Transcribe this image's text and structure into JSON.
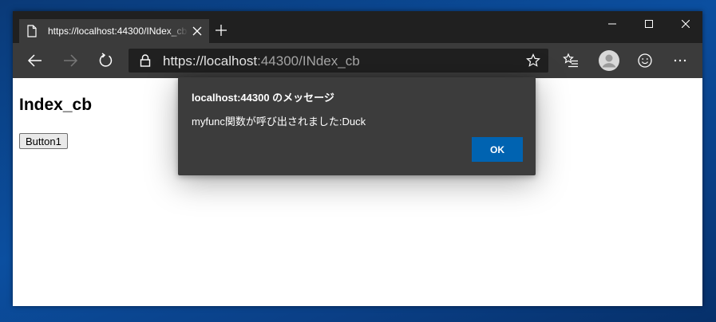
{
  "browser": {
    "tab": {
      "title": "https://localhost:44300/INdex_cb"
    },
    "address_bar": {
      "url_scheme_host": "https://localhost",
      "url_rest": ":44300/INdex_cb"
    },
    "icons": {
      "tab": "page-icon",
      "new_tab": "plus-icon",
      "back": "back-arrow-icon",
      "forward": "forward-arrow-icon",
      "refresh": "refresh-icon",
      "lock": "lock-icon",
      "favorite": "star-icon",
      "favorites": "favorites-list-icon",
      "profile": "avatar-icon",
      "feedback": "smiley-icon",
      "more": "more-icon"
    }
  },
  "page": {
    "heading": "Index_cb",
    "button_label": "Button1"
  },
  "dialog": {
    "title": "localhost:44300 のメッセージ",
    "message": "myfunc関数が呼び出されました:Duck",
    "ok_label": "OK"
  },
  "colors": {
    "desktop": "#0b4fa0",
    "titlebar": "#202020",
    "toolbar": "#3b3b3b",
    "dialog_bg": "#3c3c3c",
    "ok_button": "#0063b1"
  }
}
